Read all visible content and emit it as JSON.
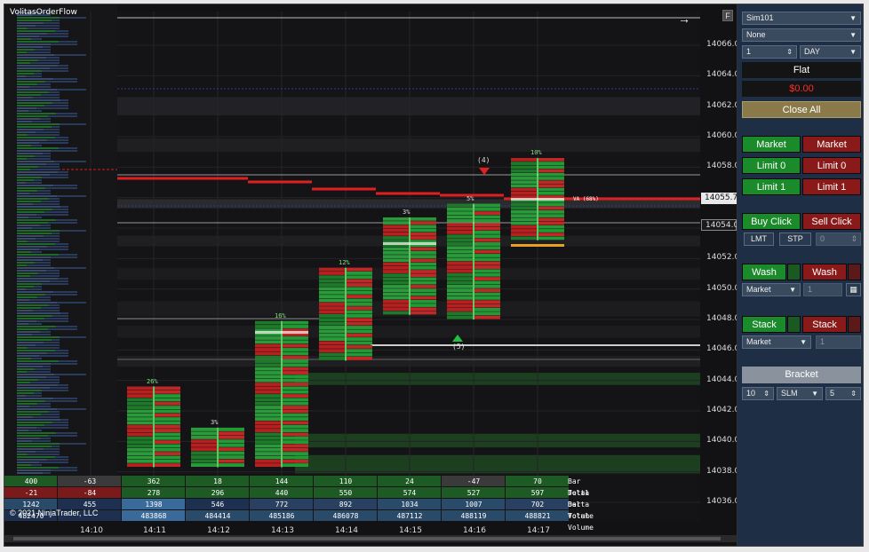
{
  "app": {
    "indicator_label": "VolitasOrderFlow",
    "copyright": "© 2021 NinjaTrader, LLC",
    "f_button": "F",
    "arrow_icon": "right-arrow-icon"
  },
  "price_axis": {
    "ticks": [
      "14066.00",
      "14064.00",
      "14062.00",
      "14060.00",
      "14058.00",
      "14056.00",
      "14054.00",
      "14052.00",
      "14050.00",
      "14048.00",
      "14046.00",
      "14044.00",
      "14042.00",
      "14040.00",
      "14038.00",
      "14036.00"
    ],
    "last_price": "14055.75",
    "second_price": "14054.00"
  },
  "time_axis": {
    "ticks": [
      "14:10",
      "14:11",
      "14:12",
      "14:13",
      "14:14",
      "14:15",
      "14:16",
      "14:17"
    ]
  },
  "stats": {
    "labels": [
      "Bar Delta",
      "Total Delta",
      "Bar Volume",
      "Total Volume"
    ],
    "bar_delta": [
      "400",
      "-63",
      "362",
      "18",
      "144",
      "110",
      "24",
      "-47",
      "70"
    ],
    "total_delta": [
      "-21",
      "-84",
      "278",
      "296",
      "440",
      "550",
      "574",
      "527",
      "597"
    ],
    "bar_volume": [
      "1242",
      "455",
      "1398",
      "546",
      "772",
      "892",
      "1034",
      "1007",
      "702"
    ],
    "total_volume": [
      "482470",
      "",
      "483868",
      "484414",
      "485186",
      "486078",
      "487112",
      "488119",
      "488821"
    ]
  },
  "bars": {
    "percent_labels": [
      "26%",
      "3%",
      "16%",
      "12%",
      "3%",
      "5%",
      "10%"
    ],
    "markers": [
      "(4)",
      "(5)"
    ],
    "vah_label": "VA (68%)"
  },
  "panel": {
    "account": "Sim101",
    "atm": "None",
    "quantity": "1",
    "tif": "DAY",
    "position": "Flat",
    "pnl": "$0.00",
    "close_all": "Close All",
    "buy_market": "Market",
    "sell_market": "Market",
    "buy_limit0": "Limit 0",
    "sell_limit0": "Limit 0",
    "buy_limit1": "Limit 1",
    "sell_limit1": "Limit 1",
    "buy_click": "Buy Click",
    "sell_click": "Sell Click",
    "lmt": "LMT",
    "stp": "STP",
    "click_qty": "0",
    "wash_buy": "Wash",
    "wash_sell": "Wash",
    "wash_type": "Market",
    "wash_qty": "1",
    "stack_buy": "Stack",
    "stack_sell": "Stack",
    "stack_type": "Market",
    "stack_qty": "1",
    "bracket": "Bracket",
    "bracket_ticks": "10",
    "bracket_type": "SLM",
    "bracket_qty": "5"
  },
  "colors": {
    "buy": "#1a8a2a",
    "sell": "#8a1a1a",
    "panel_bg": "#1e2f45",
    "chart_bg": "#121215",
    "pnl_red": "#ff2a2a",
    "close_all": "#8a7a4a"
  }
}
